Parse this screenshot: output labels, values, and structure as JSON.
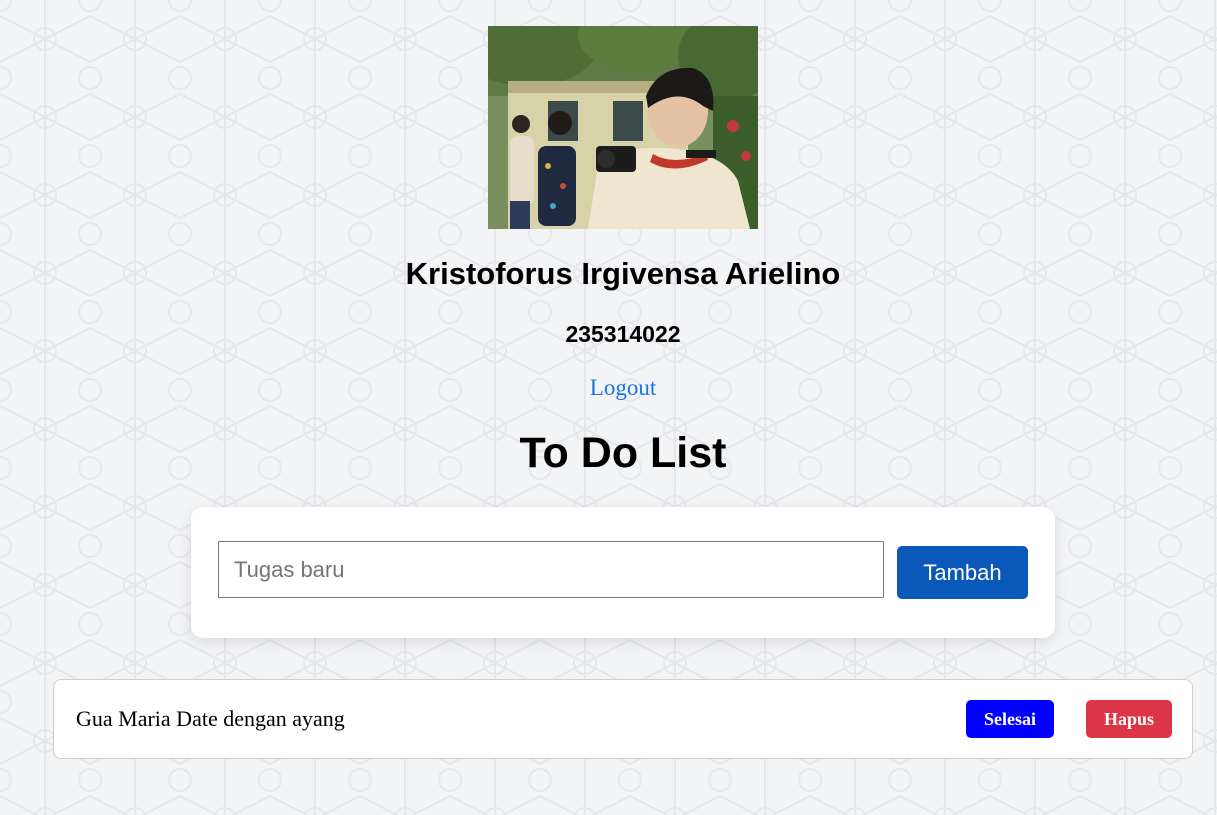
{
  "profile": {
    "name": "Kristoforus Irgivensa Arielino",
    "nim": "235314022",
    "logout_label": "Logout"
  },
  "todo": {
    "title": "To Do List",
    "input_placeholder": "Tugas baru",
    "input_value": "",
    "add_label": "Tambah",
    "tasks": [
      {
        "text": "Gua Maria Date dengan ayang",
        "done_label": "Selesai",
        "delete_label": "Hapus"
      }
    ]
  },
  "colors": {
    "background": "#f3f4f6",
    "link": "#1a73e8",
    "add_button": "#0a58ba",
    "done_button": "#0000ff",
    "delete_button": "#dc3545"
  },
  "icons": {
    "photo": "profile-photo"
  }
}
